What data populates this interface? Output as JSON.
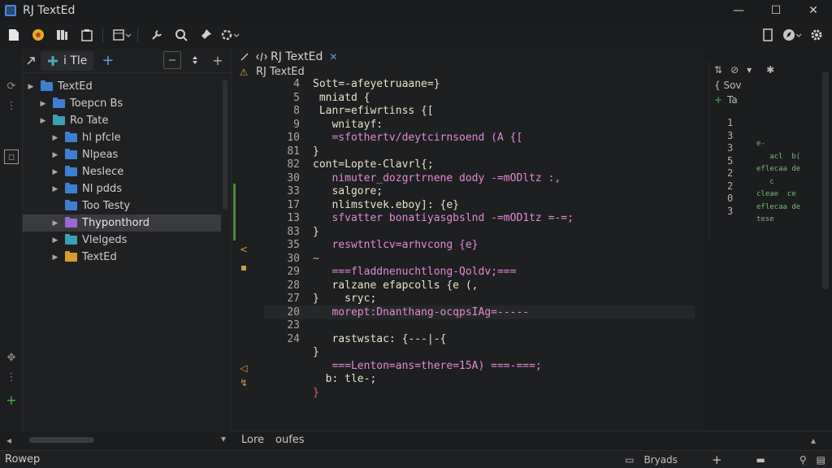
{
  "window": {
    "title": "RJ TextEd"
  },
  "window_controls": {
    "minimize": "—",
    "maximize": "☐",
    "close": "✕"
  },
  "project_panel": {
    "tab_label": "i Tle",
    "add_symbol": "+",
    "tree": [
      {
        "label": "TextEd",
        "arrow": "▶",
        "color": "blue",
        "indent": 0,
        "selected": false
      },
      {
        "label": "Toepcn Bs",
        "arrow": "▶",
        "color": "blue",
        "indent": 1,
        "selected": false
      },
      {
        "label": "Ro Tate",
        "arrow": "▶",
        "color": "teal",
        "indent": 1,
        "selected": false
      },
      {
        "label": "hl pfcle",
        "arrow": "▶",
        "color": "blue",
        "indent": 2,
        "selected": false
      },
      {
        "label": "Nlpeas",
        "arrow": "▶",
        "color": "blue",
        "indent": 2,
        "selected": false
      },
      {
        "label": "Neslece",
        "arrow": "▶",
        "color": "blue",
        "indent": 2,
        "selected": false
      },
      {
        "label": "Nl pdds",
        "arrow": "▶",
        "color": "blue",
        "indent": 2,
        "selected": false
      },
      {
        "label": "Too Testy",
        "arrow": "",
        "color": "blue",
        "indent": 2,
        "selected": false
      },
      {
        "label": "Thyponthord",
        "arrow": "▶",
        "color": "purple",
        "indent": 2,
        "selected": true
      },
      {
        "label": "Vlelgeds",
        "arrow": "▶",
        "color": "teal",
        "indent": 2,
        "selected": false
      },
      {
        "label": "TextEd",
        "arrow": "▶",
        "color": "orange",
        "indent": 2,
        "selected": false
      }
    ]
  },
  "editor": {
    "tab_label": "RJ TextEd",
    "tab_close": "✕",
    "breadcrumb": "RJ TextEd",
    "line_numbers": [
      "4",
      "5",
      "8",
      "9",
      "10",
      "81",
      "82",
      "30",
      "33",
      "17",
      "13",
      "83",
      "35",
      "30",
      "29",
      "28",
      "27",
      "20",
      "23",
      "24",
      "",
      ""
    ],
    "code_lines": [
      {
        "text": "Sott=-afeyetruaane=}",
        "cls": "c-main"
      },
      {
        "text": " mniatd {",
        "cls": "c-main"
      },
      {
        "text": " Lanr=efiwrtinss {[",
        "cls": "c-main"
      },
      {
        "text": "   wnitayf:",
        "cls": "c-main"
      },
      {
        "text": "   =sfothertv/deytcirnsoend (A {[",
        "cls": "c-kw"
      },
      {
        "text": "}",
        "cls": "c-main"
      },
      {
        "text": "cont=Lopte-Clavrl{;",
        "cls": "c-main"
      },
      {
        "text": "   nimuter_dozgrtrnene dody -=mODltz :,",
        "cls": "c-kw"
      },
      {
        "text": "   salgore;",
        "cls": "c-main"
      },
      {
        "text": "   nlimstvek.eboy]: {e}",
        "cls": "c-main"
      },
      {
        "text": "   sfvatter bonatiyasgbslnd -=mOD1tz =-=;",
        "cls": "c-kw"
      },
      {
        "text": "}",
        "cls": "c-main"
      },
      {
        "text": "   reswtntlcv=arhvcong {e}",
        "cls": "c-kw"
      },
      {
        "text": "~",
        "cls": "c-dim"
      },
      {
        "text": "   ===fladdnenuchtlong-Qoldv;===",
        "cls": "c-kw"
      },
      {
        "text": "   ralzane efapcolls {e (,",
        "cls": "c-main"
      },
      {
        "text": "}    sryc;",
        "cls": "c-main"
      },
      {
        "text": "   morept:Dnanthang-ocqpsIAg=-----",
        "cls": "c-kw"
      },
      {
        "text": "",
        "cls": "c-main"
      },
      {
        "text": "   rastwstac: {---|-{",
        "cls": "c-main"
      },
      {
        "text": "}",
        "cls": "c-main"
      },
      {
        "text": "   ===Lenton=ans=there=15A) ===-===;",
        "cls": "c-kw"
      },
      {
        "text": "  b: tle-;",
        "cls": "c-main"
      },
      {
        "text": "}",
        "cls": "c-red"
      }
    ],
    "bottom_tabs": [
      "Lore",
      "oufes"
    ]
  },
  "structure_panel": {
    "numbers": [
      "1",
      "3",
      "3",
      "5",
      "2",
      "2",
      "0",
      "3"
    ],
    "labels": [
      "{ Sov",
      "Ta"
    ]
  },
  "statusbar": {
    "left": "Rowep",
    "right_label": "Bryads"
  },
  "colors": {
    "accent": "#5a9de6",
    "keyword": "#e28ad6",
    "text": "#e8e2c8",
    "change_bar": "#4a8a3a"
  }
}
